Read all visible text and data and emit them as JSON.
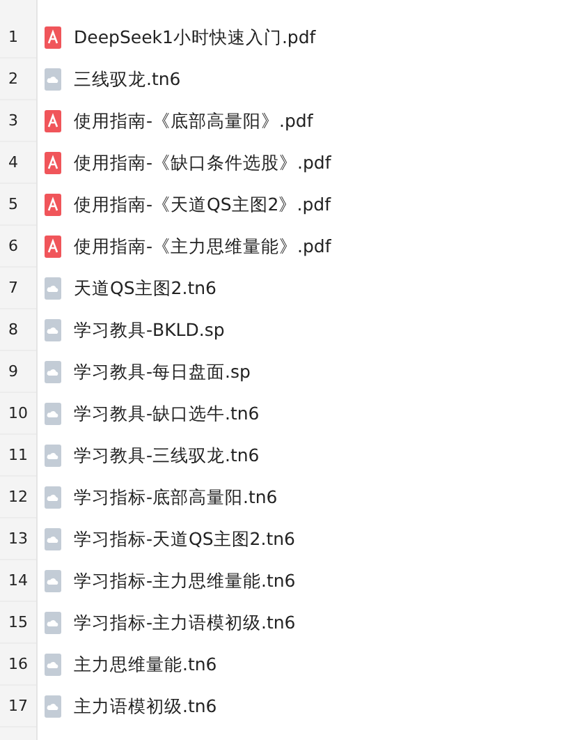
{
  "files": [
    {
      "number": "1",
      "name": "DeepSeek1小时快速入门.pdf",
      "kind": "pdf"
    },
    {
      "number": "2",
      "name": "三线驭龙.tn6",
      "kind": "file"
    },
    {
      "number": "3",
      "name": "使用指南-《底部高量阳》.pdf",
      "kind": "pdf"
    },
    {
      "number": "4",
      "name": "使用指南-《缺口条件选股》.pdf",
      "kind": "pdf"
    },
    {
      "number": "5",
      "name": "使用指南-《天道QS主图2》.pdf",
      "kind": "pdf"
    },
    {
      "number": "6",
      "name": "使用指南-《主力思维量能》.pdf",
      "kind": "pdf"
    },
    {
      "number": "7",
      "name": "天道QS主图2.tn6",
      "kind": "file"
    },
    {
      "number": "8",
      "name": "学习教具-BKLD.sp",
      "kind": "file"
    },
    {
      "number": "9",
      "name": "学习教具-每日盘面.sp",
      "kind": "file"
    },
    {
      "number": "10",
      "name": "学习教具-缺口选牛.tn6",
      "kind": "file"
    },
    {
      "number": "11",
      "name": "学习教具-三线驭龙.tn6",
      "kind": "file"
    },
    {
      "number": "12",
      "name": "学习指标-底部高量阳.tn6",
      "kind": "file"
    },
    {
      "number": "13",
      "name": "学习指标-天道QS主图2.tn6",
      "kind": "file"
    },
    {
      "number": "14",
      "name": "学习指标-主力思维量能.tn6",
      "kind": "file"
    },
    {
      "number": "15",
      "name": "学习指标-主力语模初级.tn6",
      "kind": "file"
    },
    {
      "number": "16",
      "name": "主力思维量能.tn6",
      "kind": "file"
    },
    {
      "number": "17",
      "name": "主力语模初级.tn6",
      "kind": "file"
    }
  ]
}
